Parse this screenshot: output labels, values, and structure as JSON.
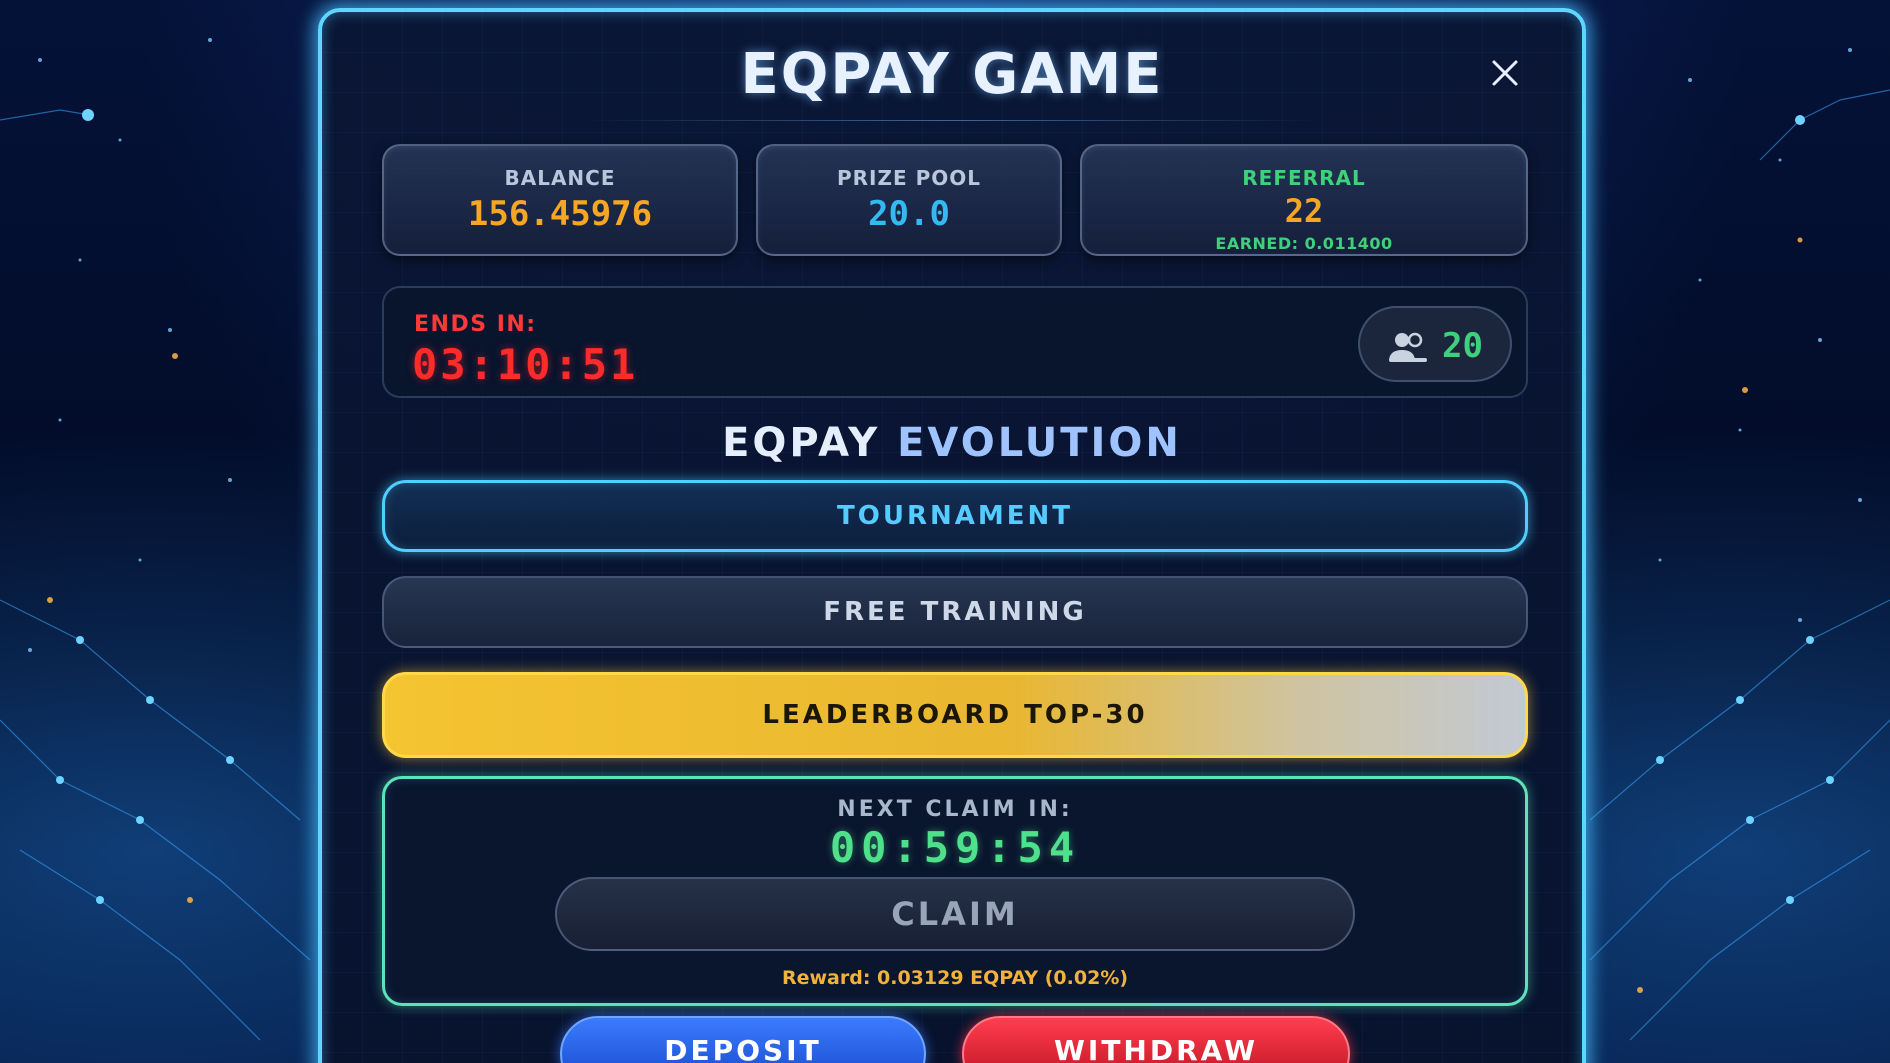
{
  "header": {
    "title": "EQPAY GAME"
  },
  "stats": {
    "balance": {
      "label": "BALANCE",
      "value": "156.45976",
      "color": "#f5a623"
    },
    "prize_pool": {
      "label": "PRIZE POOL",
      "value": "20.0",
      "color": "#34b9f0"
    },
    "referral": {
      "label": "REFERRAL",
      "value": "22",
      "sub": "EARNED: 0.011400",
      "label_color": "#3fd07c",
      "value_color": "#f5a623"
    }
  },
  "timer": {
    "label": "ENDS IN:",
    "value": "03:10:51",
    "players_count": "20",
    "players_icon": "users-icon"
  },
  "section": {
    "title_part1": "EQPAY",
    "title_part2": "EVOLUTION"
  },
  "modes": {
    "tournament_label": "TOURNAMENT",
    "training_label": "FREE TRAINING",
    "leaderboard_label": "LEADERBOARD TOP-30"
  },
  "claim": {
    "label": "NEXT CLAIM IN:",
    "timer": "00:59:54",
    "button_label": "CLAIM",
    "reward": "Reward: 0.03129 EQPAY (0.02%)"
  },
  "actions": {
    "deposit_label": "DEPOSIT",
    "withdraw_label": "WITHDRAW"
  },
  "icons": {
    "close": "close-icon",
    "players": "users-icon"
  }
}
